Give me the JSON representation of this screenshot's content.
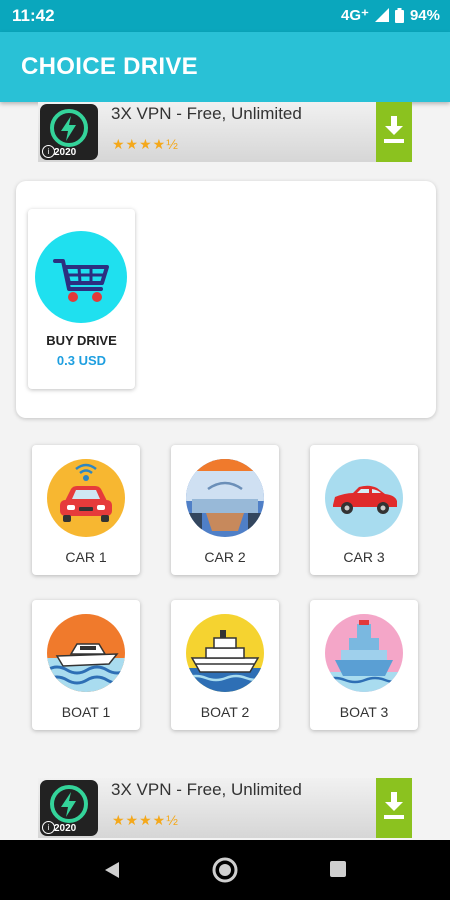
{
  "status_bar": {
    "time": "11:42",
    "network": "4G⁺",
    "battery": "94%"
  },
  "app": {
    "title": "CHOICE DRIVE"
  },
  "ad_top": {
    "title": "3X VPN - Free, Unlimited",
    "stars": "★★★★½",
    "badge_year": "2020"
  },
  "buy": {
    "label": "BUY DRIVE",
    "price": "0.3 USD"
  },
  "tiles": [
    {
      "label": "CAR 1"
    },
    {
      "label": "CAR 2"
    },
    {
      "label": "CAR 3"
    },
    {
      "label": "BOAT 1"
    },
    {
      "label": "BOAT 2"
    },
    {
      "label": "BOAT 3"
    }
  ],
  "ad_bottom": {
    "title": "3X VPN - Free, Unlimited",
    "stars": "★★★★½",
    "badge_year": "2020"
  },
  "colors": {
    "appbar": "#29c1d6",
    "status": "#0aa7bd",
    "ad_download": "#8bc21f",
    "price": "#1e9fe0"
  }
}
